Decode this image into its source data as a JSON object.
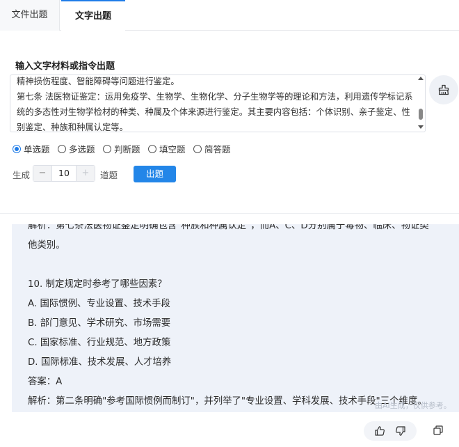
{
  "tabs": [
    {
      "label": "文件出题",
      "active": false
    },
    {
      "label": "文字出题",
      "active": true
    }
  ],
  "input_section": {
    "title": "输入文字材料或指令出题",
    "text": "精神损伤程度、智能障碍等问题进行鉴定。\n第七条 法医物证鉴定：运用免疫学、生物学、生物化学、分子生物学等的理论和方法，利用遗传学标记系统的多态性对生物学检材的种类、种属及个体来源进行鉴定。其主要内容包括：个体识别、亲子鉴定、性别鉴定、种族和种属认定等。",
    "clean_icon": "broom-clean-icon"
  },
  "question_types": [
    {
      "label": "单选题",
      "checked": true
    },
    {
      "label": "多选题",
      "checked": false
    },
    {
      "label": "判断题",
      "checked": false
    },
    {
      "label": "填空题",
      "checked": false
    },
    {
      "label": "简答题",
      "checked": false
    }
  ],
  "generate": {
    "prefix": "生成",
    "minus": "−",
    "value": "10",
    "plus": "+",
    "unit": "道题",
    "button": "出题"
  },
  "answer": {
    "lines": [
      "解析：第七条法医物证鉴定明确包含\"种族和种属认定\"，而A、C、D分别属于毒物、临床、物证类",
      "他类别。",
      "",
      "10. 制定规定时参考了哪些因素？",
      "A. 国际惯例、专业设置、技术手段",
      "B. 部门意见、学术研究、市场需要",
      "C. 国家标准、行业规范、地方政策",
      "D. 国际标准、技术发展、人才培养",
      "答案：A",
      "解析：第二条明确\"参考国际惯例而制订\"，并列举了\"专业设置、学科发展、技术手段\"三个维度。"
    ],
    "watermark": "由AI生成，仅供参考。"
  },
  "actions": {
    "like_icon": "thumbs-up-icon",
    "dislike_icon": "thumbs-down-icon",
    "copy_icon": "copy-icon"
  },
  "colors": {
    "accent": "#2386e8",
    "panel_bg": "#eef2f9"
  }
}
